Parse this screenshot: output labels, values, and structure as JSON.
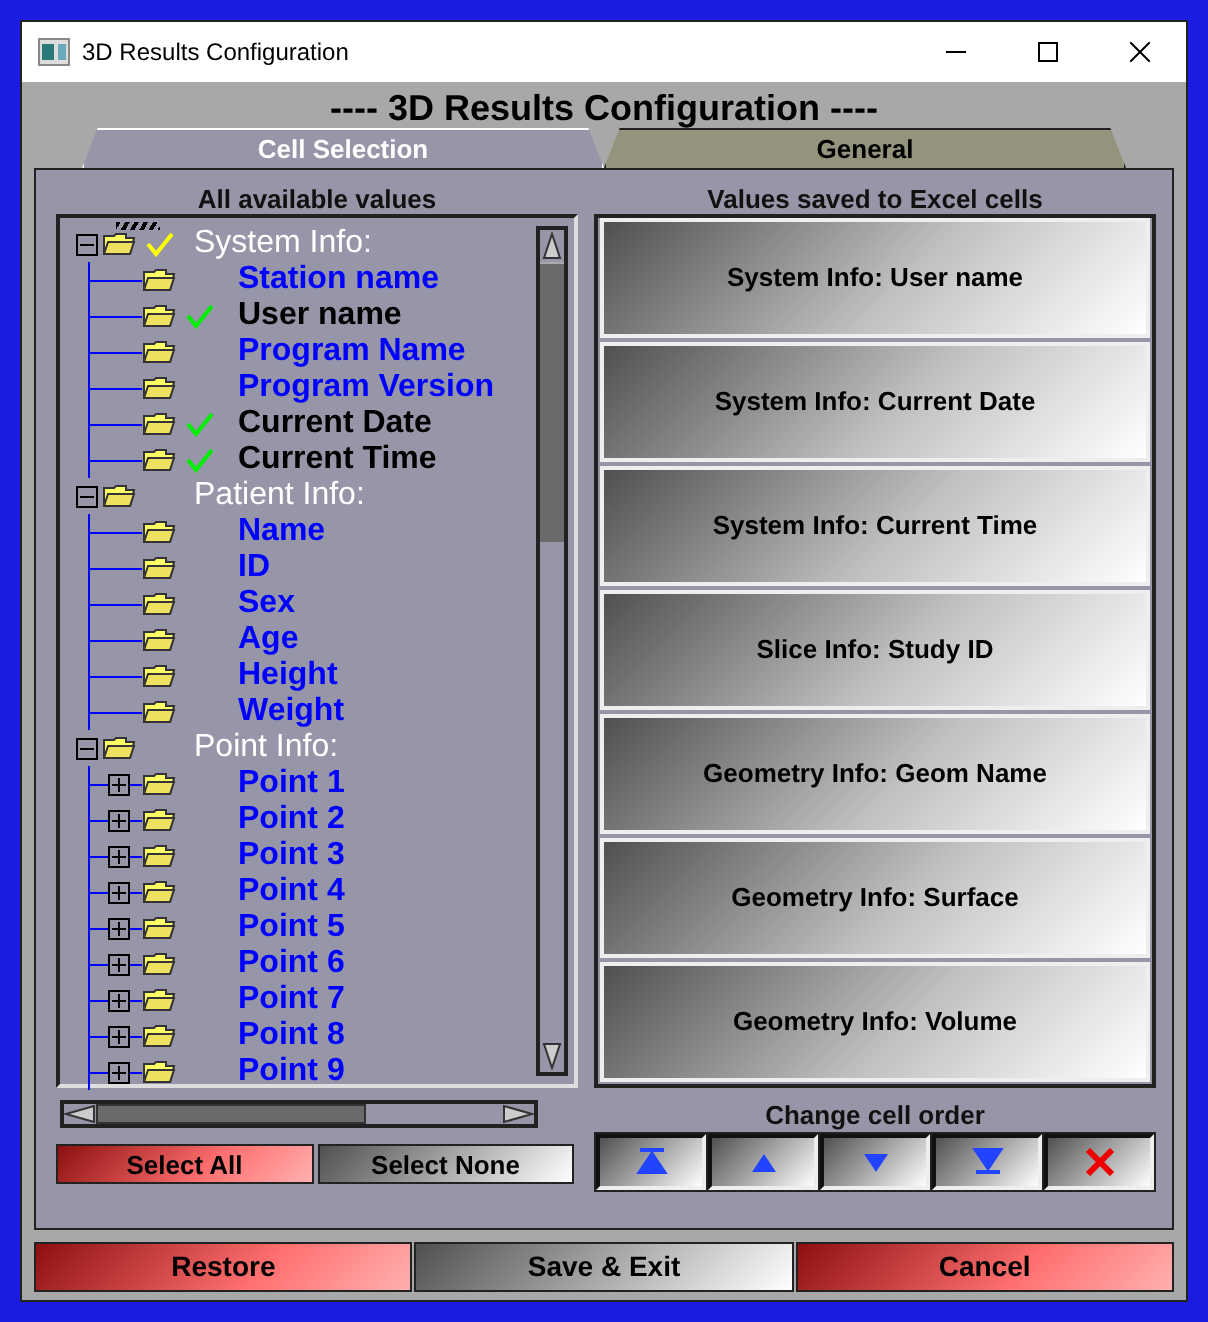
{
  "window": {
    "title": "3D Results Configuration"
  },
  "heading": "---- 3D Results Configuration ----",
  "tabs": [
    {
      "label": "Cell Selection",
      "selected": true
    },
    {
      "label": "General",
      "selected": false
    }
  ],
  "left_panel": {
    "title": "All available values",
    "tree": [
      {
        "label": "System Info:",
        "expanded": true,
        "checked": true,
        "children": [
          {
            "label": "Station name",
            "checked": false
          },
          {
            "label": "User name",
            "checked": true
          },
          {
            "label": "Program Name",
            "checked": false
          },
          {
            "label": "Program Version",
            "checked": false
          },
          {
            "label": "Current Date",
            "checked": true
          },
          {
            "label": "Current Time",
            "checked": true
          }
        ]
      },
      {
        "label": "Patient Info:",
        "expanded": true,
        "checked": false,
        "children": [
          {
            "label": "Name",
            "checked": false
          },
          {
            "label": "ID",
            "checked": false
          },
          {
            "label": "Sex",
            "checked": false
          },
          {
            "label": "Age",
            "checked": false
          },
          {
            "label": "Height",
            "checked": false
          },
          {
            "label": "Weight",
            "checked": false
          }
        ]
      },
      {
        "label": "Point Info:",
        "expanded": true,
        "checked": false,
        "children": [
          {
            "label": "Point 1",
            "checked": false,
            "expanded": false
          },
          {
            "label": "Point 2",
            "checked": false,
            "expanded": false
          },
          {
            "label": "Point 3",
            "checked": false,
            "expanded": false
          },
          {
            "label": "Point 4",
            "checked": false,
            "expanded": false
          },
          {
            "label": "Point 5",
            "checked": false,
            "expanded": false
          },
          {
            "label": "Point 6",
            "checked": false,
            "expanded": false
          },
          {
            "label": "Point 7",
            "checked": false,
            "expanded": false
          },
          {
            "label": "Point 8",
            "checked": false,
            "expanded": false
          },
          {
            "label": "Point 9",
            "checked": false,
            "expanded": false
          }
        ]
      }
    ],
    "buttons": [
      {
        "label": "Select All",
        "kind": "warning"
      },
      {
        "label": "Select None",
        "kind": "normal"
      }
    ]
  },
  "right_panel": {
    "title": "Values saved to Excel cells",
    "cells": [
      "System Info: User name",
      "System Info: Current Date",
      "System Info: Current Time",
      "Slice Info: Study ID",
      "Geometry Info: Geom Name",
      "Geometry Info: Surface",
      "Geometry Info: Volume"
    ],
    "order_label": "Change cell order",
    "order_buttons": [
      {
        "kind": "top"
      },
      {
        "kind": "up"
      },
      {
        "kind": "down"
      },
      {
        "kind": "bottom"
      },
      {
        "kind": "delete"
      }
    ]
  },
  "footer_buttons": [
    {
      "label": "Restore",
      "kind": "warning"
    },
    {
      "label": "Save & Exit",
      "kind": "normal"
    },
    {
      "label": "Cancel",
      "kind": "warning"
    }
  ]
}
